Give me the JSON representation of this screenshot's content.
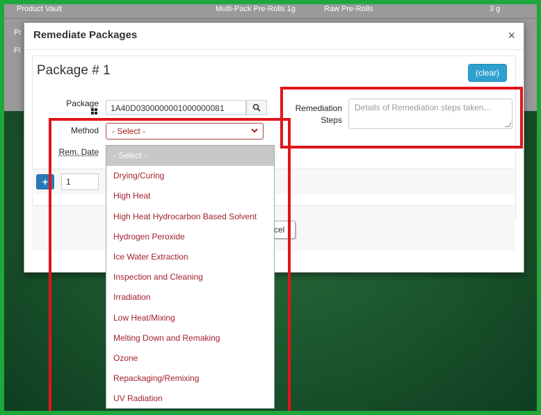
{
  "background_table": {
    "row1": [
      "Product Vault",
      "Multi-Pack Pre-Rolls 1g",
      "Raw Pre-Rolls",
      "3 g"
    ],
    "row2_cell": "Pr",
    "row3_cell": "Fl"
  },
  "modal": {
    "title": "Remediate Packages",
    "close_glyph": "×",
    "package_heading": "Package # 1",
    "clear_label": "(clear)",
    "package_label": "Package",
    "package_value": "1A40D0300000001000000081",
    "method_label": "Method",
    "method_selected": "- Select -",
    "rem_date_label": "Rem. Date",
    "remediation_label_line1": "Remediation",
    "remediation_label_line2": "Steps",
    "remediation_placeholder": "Details of Remediation steps taken...",
    "add_label": "+",
    "quantity_value": "1",
    "cancel_label_visible": "cel"
  },
  "method_options": [
    "- Select -",
    "Drying/Curing",
    "High Heat",
    "High Heat Hydrocarbon Based Solvent",
    "Hydrogen Peroxide",
    "Ice Water Extraction",
    "Inspection and Cleaning",
    "Irradiation",
    "Low Heat/Mixing",
    "Melting Down and Remaking",
    "Ozone",
    "Repackaging/Remixing",
    "UV Radiation"
  ],
  "colors": {
    "annotation_red": "#e0151b",
    "option_text": "#a0202e",
    "clear_button": "#2f9fd0",
    "frame_green": "#1ea83c"
  },
  "icons": {
    "search": "search-icon",
    "barcode": "barcode-icon",
    "chevron": "chevron-down-icon",
    "close": "close-icon"
  }
}
